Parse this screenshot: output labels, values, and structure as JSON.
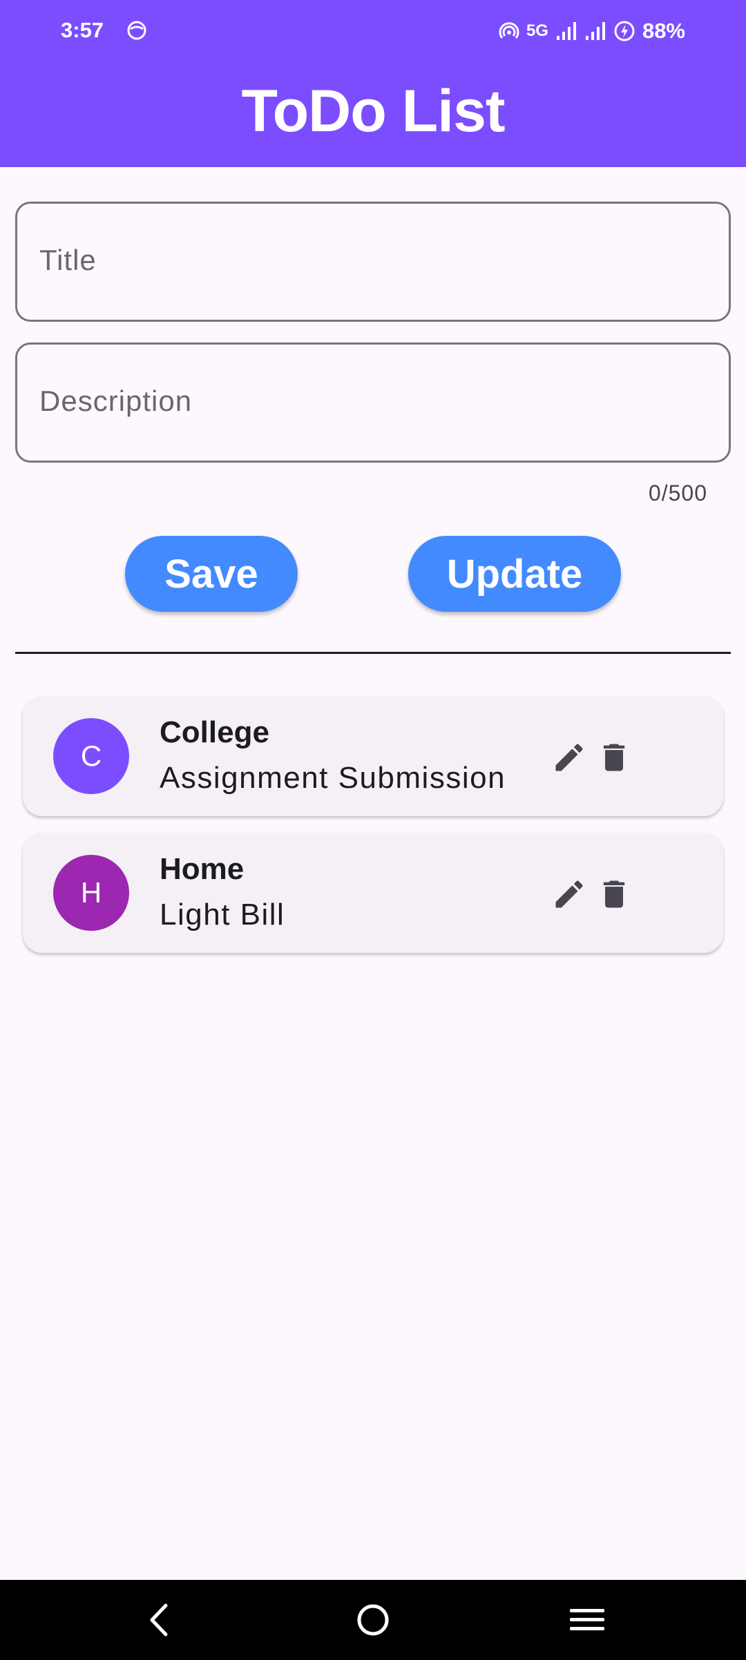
{
  "status_bar": {
    "time": "3:57",
    "network": "5G",
    "battery": "88%",
    "icons": [
      "app-notification-icon",
      "hotspot-icon",
      "signal-icon",
      "signal-icon",
      "battery-charging-icon"
    ]
  },
  "app_bar": {
    "title": "ToDo List",
    "background": "#7c4dff"
  },
  "form": {
    "title_placeholder": "Title",
    "description_placeholder": "Description",
    "char_counter": "0/500"
  },
  "buttons": {
    "save_label": "Save",
    "update_label": "Update",
    "color": "#448aff"
  },
  "todos": [
    {
      "avatar_letter": "C",
      "avatar_color": "#7c4dff",
      "title": "College",
      "description": "Assignment Submission",
      "actions": [
        "edit-icon",
        "delete-icon"
      ]
    },
    {
      "avatar_letter": "H",
      "avatar_color": "#9c27b0",
      "title": "Home",
      "description": "Light Bill",
      "actions": [
        "edit-icon",
        "delete-icon"
      ]
    }
  ],
  "nav_bar": {
    "icons": [
      "back-icon",
      "home-icon",
      "recents-icon"
    ]
  }
}
